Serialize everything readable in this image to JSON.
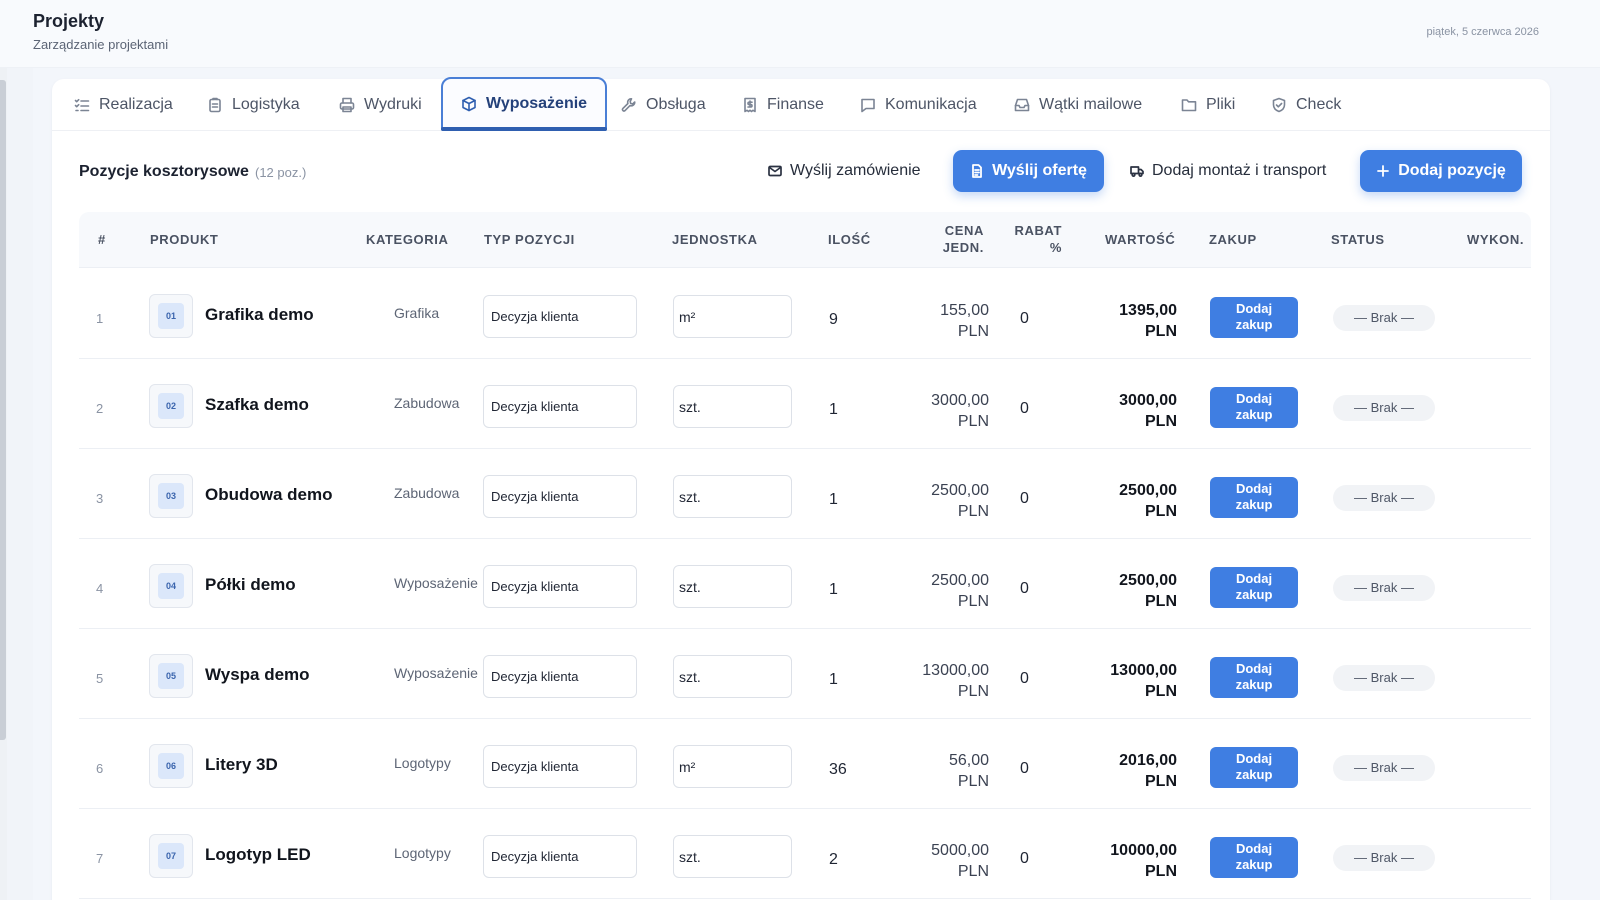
{
  "header": {
    "title": "Projekty",
    "subtitle": "Zarządzanie projektami",
    "date": "piątek, 5 czerwca 2026"
  },
  "tabs": [
    {
      "label": "Realizacja",
      "icon": "list-check-icon"
    },
    {
      "label": "Logistyka",
      "icon": "clipboard-icon"
    },
    {
      "label": "Wydruki",
      "icon": "printer-icon"
    },
    {
      "label": "Wyposażenie",
      "icon": "box-icon",
      "active": true
    },
    {
      "label": "Obsługa",
      "icon": "wrench-icon"
    },
    {
      "label": "Finanse",
      "icon": "receipt-icon"
    },
    {
      "label": "Komunikacja",
      "icon": "message-icon"
    },
    {
      "label": "Wątki mailowe",
      "icon": "inbox-icon"
    },
    {
      "label": "Pliki",
      "icon": "folder-icon"
    },
    {
      "label": "Check",
      "icon": "shield-check-icon"
    }
  ],
  "section": {
    "title": "Pozycje kosztorysowe",
    "count": "(12 poz.)"
  },
  "actions": {
    "send_order": "Wyślij zamówienie",
    "send_offer": "Wyślij ofertę",
    "add_assembly": "Dodaj montaż i transport",
    "add_item": "Dodaj pozycję"
  },
  "table": {
    "headers": {
      "num": "#",
      "product": "PRODUKT",
      "category": "KATEGORIA",
      "type": "TYP POZYCJI",
      "unit": "JEDNOSTKA",
      "qty": "ILOŚĆ",
      "price_1": "CENA",
      "price_2": "JEDN.",
      "rabat_1": "RABAT",
      "rabat_2": "%",
      "value": "WARTOŚĆ",
      "buy": "ZAKUP",
      "status": "STATUS",
      "executor": "WYKON."
    },
    "rows": [
      {
        "num": "1",
        "code": "01",
        "product": "Grafika demo",
        "category": "Grafika",
        "type": "Decyzja klienta",
        "unit": "m²",
        "qty": "9",
        "price": "155,00",
        "currency": "PLN",
        "rabat": "0",
        "value": "1395,00",
        "buy_1": "Dodaj",
        "buy_2": "zakup",
        "status": "— Brak —"
      },
      {
        "num": "2",
        "code": "02",
        "product": "Szafka demo",
        "category": "Zabudowa",
        "type": "Decyzja klienta",
        "unit": "szt.",
        "qty": "1",
        "price": "3000,00",
        "currency": "PLN",
        "rabat": "0",
        "value": "3000,00",
        "buy_1": "Dodaj",
        "buy_2": "zakup",
        "status": "— Brak —"
      },
      {
        "num": "3",
        "code": "03",
        "product": "Obudowa demo",
        "category": "Zabudowa",
        "type": "Decyzja klienta",
        "unit": "szt.",
        "qty": "1",
        "price": "2500,00",
        "currency": "PLN",
        "rabat": "0",
        "value": "2500,00",
        "buy_1": "Dodaj",
        "buy_2": "zakup",
        "status": "— Brak —"
      },
      {
        "num": "4",
        "code": "04",
        "product": "Półki demo",
        "category": "Wyposażenie",
        "type": "Decyzja klienta",
        "unit": "szt.",
        "qty": "1",
        "price": "2500,00",
        "currency": "PLN",
        "rabat": "0",
        "value": "2500,00",
        "buy_1": "Dodaj",
        "buy_2": "zakup",
        "status": "— Brak —"
      },
      {
        "num": "5",
        "code": "05",
        "product": "Wyspa demo",
        "category": "Wyposażenie",
        "type": "Decyzja klienta",
        "unit": "szt.",
        "qty": "1",
        "price": "13000,00",
        "currency": "PLN",
        "rabat": "0",
        "value": "13000,00",
        "buy_1": "Dodaj",
        "buy_2": "zakup",
        "status": "— Brak —"
      },
      {
        "num": "6",
        "code": "06",
        "product": "Litery 3D",
        "category": "Logotypy",
        "type": "Decyzja klienta",
        "unit": "m²",
        "qty": "36",
        "price": "56,00",
        "currency": "PLN",
        "rabat": "0",
        "value": "2016,00",
        "buy_1": "Dodaj",
        "buy_2": "zakup",
        "status": "— Brak —"
      },
      {
        "num": "7",
        "code": "07",
        "product": "Logotyp LED",
        "category": "Logotypy",
        "type": "Decyzja klienta",
        "unit": "szt.",
        "qty": "2",
        "price": "5000,00",
        "currency": "PLN",
        "rabat": "0",
        "value": "10000,00",
        "buy_1": "Dodaj",
        "buy_2": "zakup",
        "status": "— Brak —"
      }
    ]
  }
}
